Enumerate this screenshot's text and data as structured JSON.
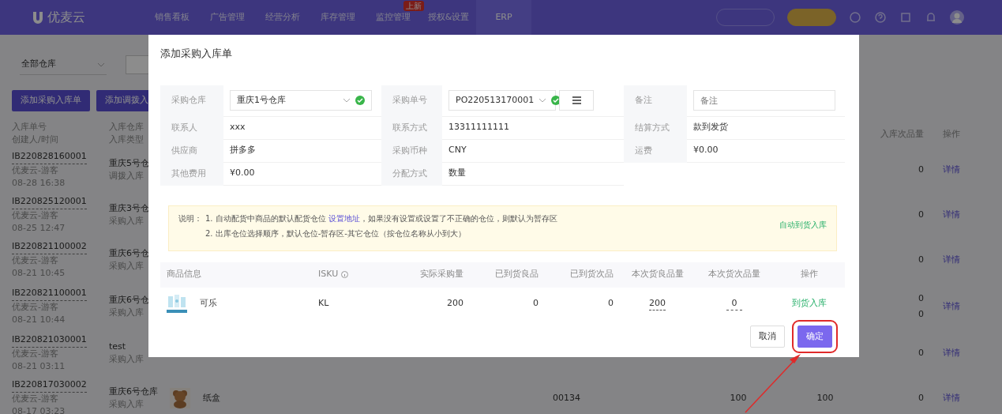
{
  "nav": {
    "logo": "优麦云",
    "items": [
      {
        "label": "销售看板",
        "selected": false
      },
      {
        "label": "广告管理",
        "selected": false
      },
      {
        "label": "经营分析",
        "selected": false
      },
      {
        "label": "库存管理",
        "selected": false
      },
      {
        "label": "监控管理",
        "selected": false,
        "badge": "上新"
      },
      {
        "label": "授权&设置",
        "selected": false
      },
      {
        "label": "ERP",
        "selected": true
      }
    ]
  },
  "filters": {
    "warehouse": "全部仓库"
  },
  "actions": [
    "添加采购入库单",
    "添加调拨入"
  ],
  "list": {
    "columns": {
      "order": "入库单号",
      "creator_time": "创建人/时间",
      "warehouse": "入库仓库",
      "type": "入库类型",
      "defective": "入库次品量",
      "action": "操作"
    },
    "rows": [
      {
        "order": "IB220828160001",
        "creator": "优麦云-游客",
        "time": "08-28 16:38",
        "warehouse": "重庆5号仓",
        "type": "调拨入库",
        "defective": [
          "0"
        ],
        "action": "详情"
      },
      {
        "order": "IB220825120001",
        "creator": "优麦云-游客",
        "time": "08-25 12:47",
        "warehouse": "重庆3号仓",
        "type": "采购入库",
        "defective": [
          "0"
        ],
        "action": "详情"
      },
      {
        "order": "IB220821100002",
        "creator": "优麦云-游客",
        "time": "08-21 10:45",
        "warehouse": "重庆6号仓",
        "type": "采购入库",
        "defective": [
          "0"
        ],
        "action": "详情"
      },
      {
        "order": "IB220821100001",
        "creator": "优麦云-游客",
        "time": "08-21 10:44",
        "warehouse": "重庆6号仓",
        "type": "采购入库",
        "defective": [
          "0",
          "0"
        ],
        "action": "详情"
      },
      {
        "order": "IB220821030001",
        "creator": "优麦云-游客",
        "time": "08-21 03:11",
        "warehouse": "test",
        "type": "采购入库",
        "defective": [
          "0"
        ],
        "action": "详情"
      },
      {
        "order": "IB220817030002",
        "creator": "优麦云-游客",
        "time": "08-17 03:23",
        "warehouse": "重庆6号仓库",
        "type": "采购入库",
        "product": {
          "kind": "picture",
          "name": "纸盒"
        },
        "sku": "00134",
        "qty_1": "100",
        "qty_2": "100",
        "defective": [
          "0"
        ],
        "action": "详情"
      }
    ]
  },
  "dialog": {
    "title": "添加采购入库单",
    "form": [
      {
        "kind": "select",
        "label": "采购仓库",
        "value": "重庆1号仓库",
        "valid": true
      },
      {
        "kind": "select_menu",
        "label": "采购单号",
        "value": "PO220513170001",
        "valid": true
      },
      {
        "kind": "input",
        "label": "备注",
        "placeholder": "备注"
      },
      {
        "kind": "text",
        "label": "联系人",
        "value": "xxx"
      },
      {
        "kind": "text",
        "label": "联系方式",
        "value": "13311111111"
      },
      {
        "kind": "text",
        "label": "结算方式",
        "value": "款到发货"
      },
      {
        "kind": "text",
        "label": "供应商",
        "value": "拼多多"
      },
      {
        "kind": "text",
        "label": "采购币种",
        "value": "CNY"
      },
      {
        "kind": "text",
        "label": "运费",
        "value": "¥0.00"
      },
      {
        "kind": "text",
        "label": "其他费用",
        "value": "¥0.00"
      },
      {
        "kind": "text",
        "label": "分配方式",
        "value": "数量"
      }
    ],
    "notice": {
      "label": "说明：",
      "line_1": {
        "before": "1. 自动配货中商品的默认配货仓位 ",
        "link": "设置地址",
        "after": "，如果没有设置或设置了不正确的仓位，则默认为暂存区"
      },
      "line_2": "2. 出库仓位选择顺序，默认仓位-暂存区-其它仓位（按仓位名称从小到大）",
      "action": "自动到货入库"
    },
    "items": {
      "columns": [
        {
          "label": "商品信息"
        },
        {
          "label": "ISKU",
          "info": true
        },
        {
          "label": "实际采购量"
        },
        {
          "label": "已到货良品"
        },
        {
          "label": "已到货次品"
        },
        {
          "label": "本次货良品量"
        },
        {
          "label": "本次货次品量"
        },
        {
          "label": "操作"
        }
      ],
      "rows": [
        {
          "cells": [
            {
              "kind": "product",
              "name": "可乐"
            },
            {
              "kind": "text",
              "value": "KL"
            },
            {
              "kind": "text",
              "value": "200"
            },
            {
              "kind": "text",
              "value": "0"
            },
            {
              "kind": "text",
              "value": "0"
            },
            {
              "kind": "input",
              "value": "200"
            },
            {
              "kind": "input",
              "value": "0"
            },
            {
              "kind": "link",
              "value": "到货入库"
            }
          ]
        }
      ]
    },
    "buttons": [
      {
        "label": "取消",
        "kind": "secondary",
        "highlighted": false
      },
      {
        "label": "确定",
        "kind": "primary",
        "highlighted": true
      }
    ]
  }
}
